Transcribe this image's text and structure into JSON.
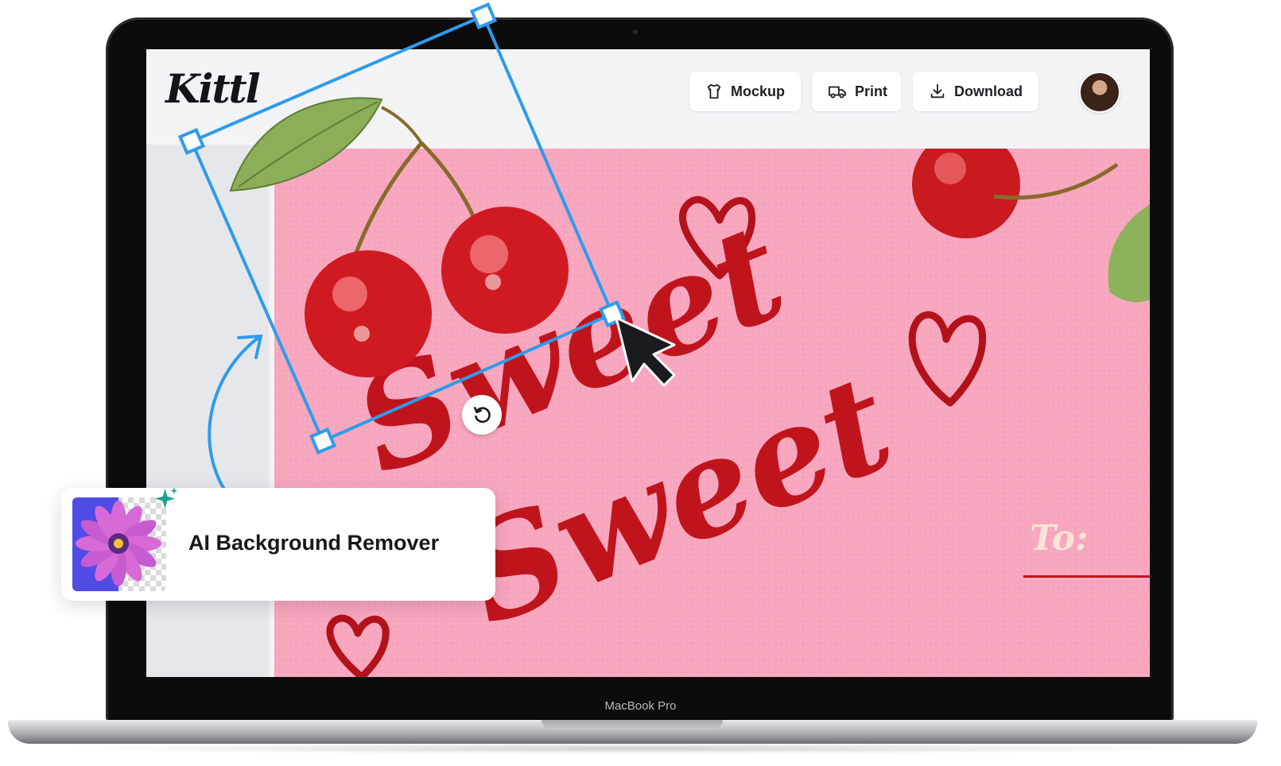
{
  "app": {
    "logo_text": "Kittl"
  },
  "toolbar": {
    "buttons": [
      {
        "label": "Mockup",
        "icon": "shirt-icon"
      },
      {
        "label": "Print",
        "icon": "truck-icon"
      },
      {
        "label": "Download",
        "icon": "download-icon"
      }
    ]
  },
  "canvas": {
    "background_color": "#f7a6be",
    "script_color": "#c0141c",
    "words": [
      "Sweet",
      "Sweet"
    ],
    "to_label": "To:"
  },
  "selection": {
    "color": "#2f9bea",
    "rotate_icon": "rotate-icon"
  },
  "feature_card": {
    "label": "AI Background Remover",
    "sparkle_color": "#1fa38f"
  },
  "device": {
    "brand_label": "MacBook Pro"
  }
}
